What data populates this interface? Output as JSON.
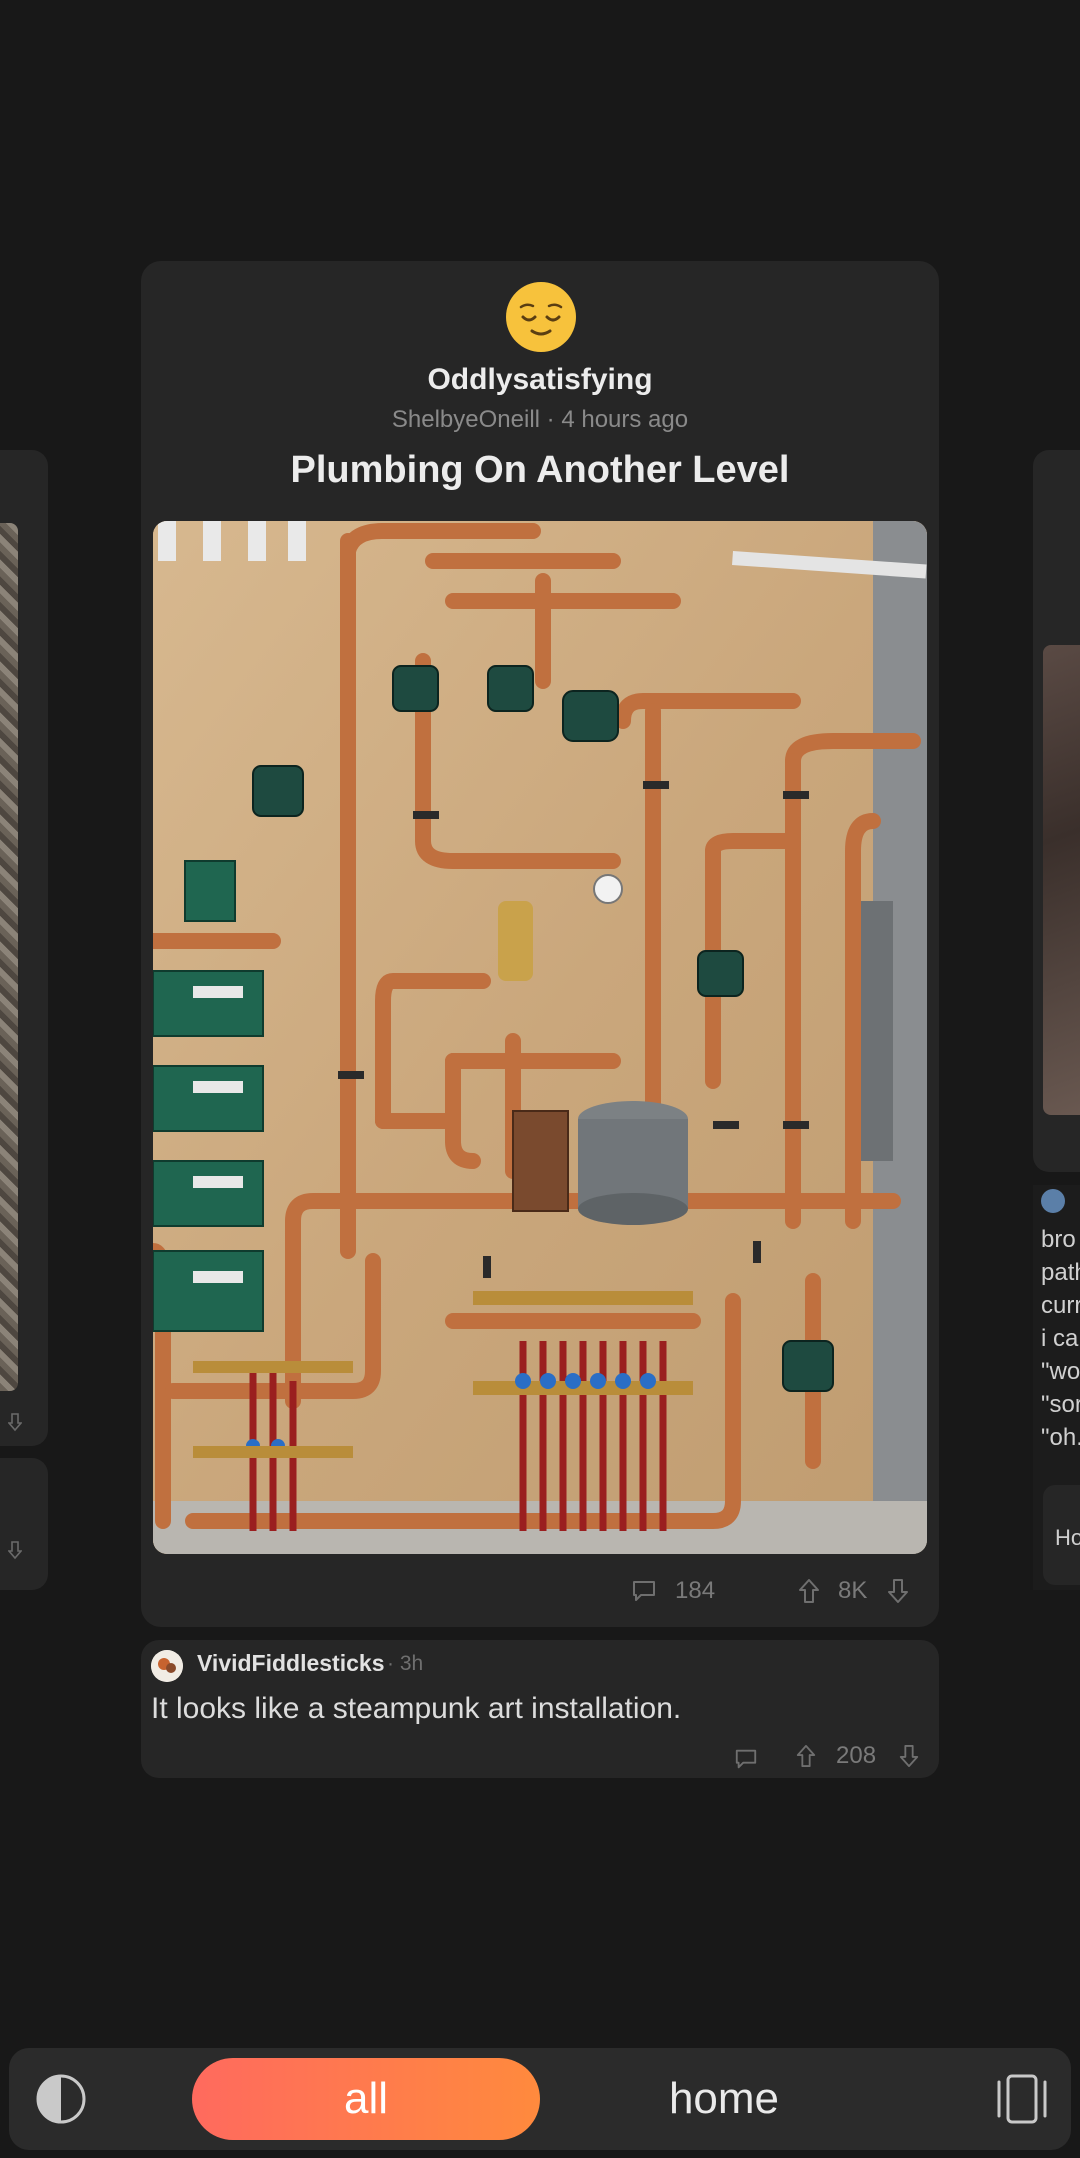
{
  "feed": {
    "post": {
      "subreddit": "Oddlysatisfying",
      "author": "ShelbyeOneill",
      "separator": "·",
      "time": "4 hours ago",
      "title": "Plumbing On Another Level",
      "comments": "184",
      "score": "8K",
      "image_alt": "Copper plumbing manifold on plywood wall"
    },
    "comment": {
      "author": "VividFiddlesticks",
      "time": "· 3h",
      "text": "It looks like a steampunk art installation.",
      "score": "208"
    },
    "peek_right": {
      "text": "bro\npath\ncurr\ni car\n\"wo\n\"sor\n\"oh.",
      "reply": "Ho"
    }
  },
  "nav": {
    "all": "all",
    "home": "home"
  },
  "icons": {
    "sub_avatar": "relieved-face-icon",
    "comment": "comment-icon",
    "upvote": "upvote-arrow-icon",
    "downvote": "downvote-arrow-icon",
    "theme": "contrast-icon",
    "layout": "card-stack-icon"
  },
  "colors": {
    "background": "#181818",
    "card": "#262626",
    "accent_start": "#ff6a5e",
    "accent_end": "#ff8a3d",
    "muted": "#7a7a7a"
  }
}
